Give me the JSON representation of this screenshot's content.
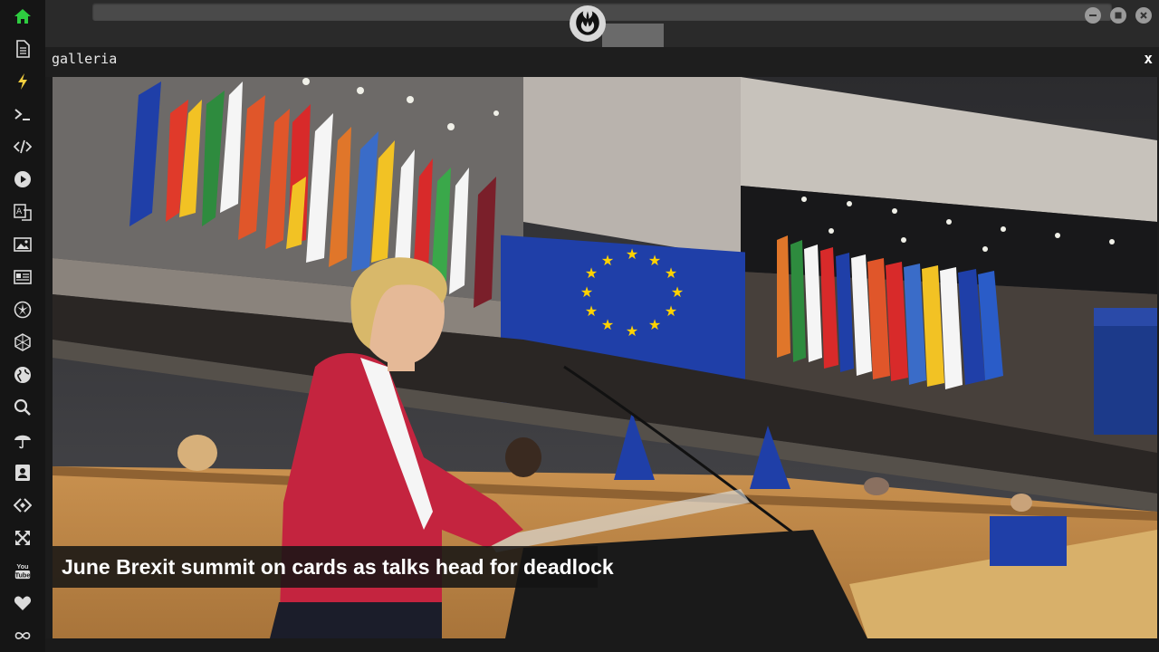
{
  "window": {
    "title": "galleria",
    "close_label": "x"
  },
  "sidebar": {
    "items": [
      {
        "icon": "home-icon",
        "active": true
      },
      {
        "icon": "document-icon"
      },
      {
        "icon": "lightning-icon"
      },
      {
        "icon": "terminal-icon"
      },
      {
        "icon": "code-icon"
      },
      {
        "icon": "play-icon"
      },
      {
        "icon": "translate-icon"
      },
      {
        "icon": "image-icon"
      },
      {
        "icon": "news-icon"
      },
      {
        "icon": "rebel-alliance-icon"
      },
      {
        "icon": "hexagon-icon"
      },
      {
        "icon": "globe-icon"
      },
      {
        "icon": "search-icon"
      },
      {
        "icon": "umbrella-icon"
      },
      {
        "icon": "contact-card-icon"
      },
      {
        "icon": "code-tag-icon"
      },
      {
        "icon": "expand-icon"
      },
      {
        "icon": "youtube-icon",
        "text": "You Tube"
      },
      {
        "icon": "heart-icon"
      },
      {
        "icon": "infinity-icon"
      }
    ]
  },
  "gallery": {
    "caption": "June Brexit summit on cards as talks head for deadlock"
  },
  "colors": {
    "accent_green": "#2ecc40",
    "eu_blue": "#1f3fa8",
    "eu_yellow": "#ffd200",
    "jacket_red": "#c4243f"
  }
}
